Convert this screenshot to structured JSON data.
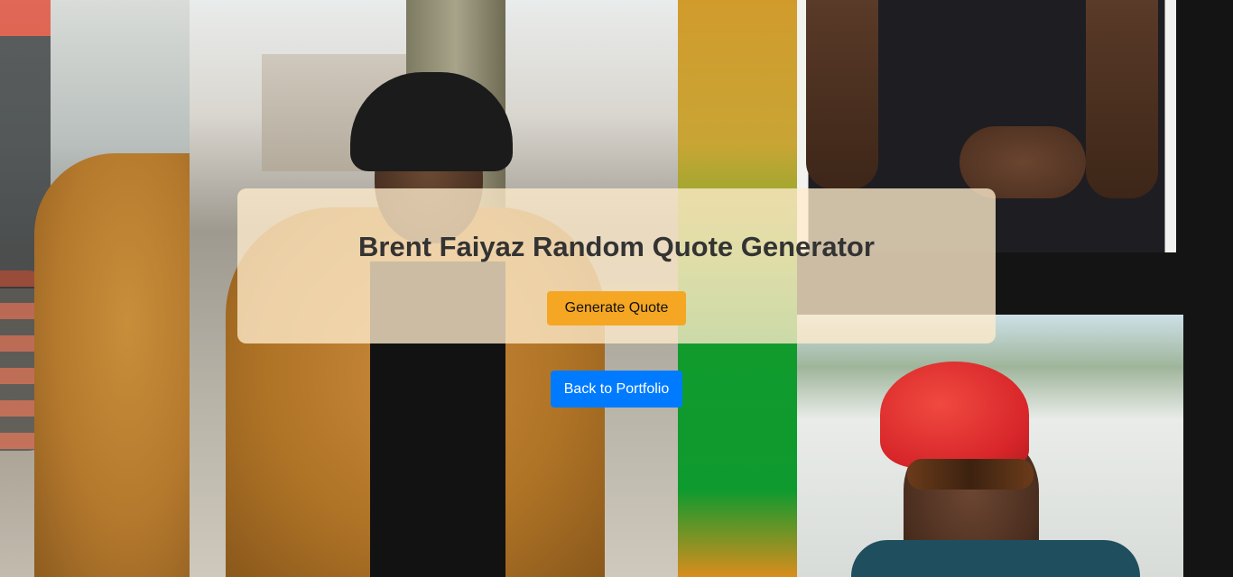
{
  "quote_card": {
    "title": "Brent Faiyaz Random Quote Generator",
    "generate_button_label": "Generate Quote"
  },
  "navigation": {
    "back_button_label": "Back to Portfolio"
  },
  "colors": {
    "generate_button_bg": "#f5a623",
    "back_button_bg": "#007bff",
    "card_bg": "rgba(255, 236, 204, 0.78)",
    "title_text": "#333333"
  }
}
